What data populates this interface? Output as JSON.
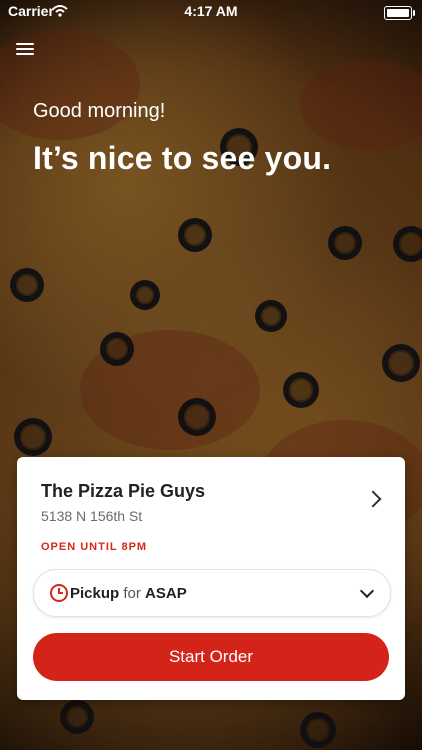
{
  "status_bar": {
    "carrier": "Carrier",
    "time": "4:17 AM",
    "battery_level": 1.0
  },
  "header": {
    "menu_icon": "hamburger-menu-icon",
    "greeting": "Good morning!",
    "headline": "It’s nice to see you."
  },
  "store_card": {
    "name": "The Pizza Pie Guys",
    "address": "5138 N 156th St",
    "status": "OPEN UNTIL 8PM",
    "status_color": "#d4281d",
    "navigate_icon": "chevron-right-icon"
  },
  "order_mode": {
    "icon": "clock-icon",
    "mode": "Pickup",
    "connector": "for",
    "time": "ASAP",
    "expand_icon": "chevron-down-icon"
  },
  "primary_action": {
    "label": "Start Order",
    "color": "#d4241a"
  }
}
